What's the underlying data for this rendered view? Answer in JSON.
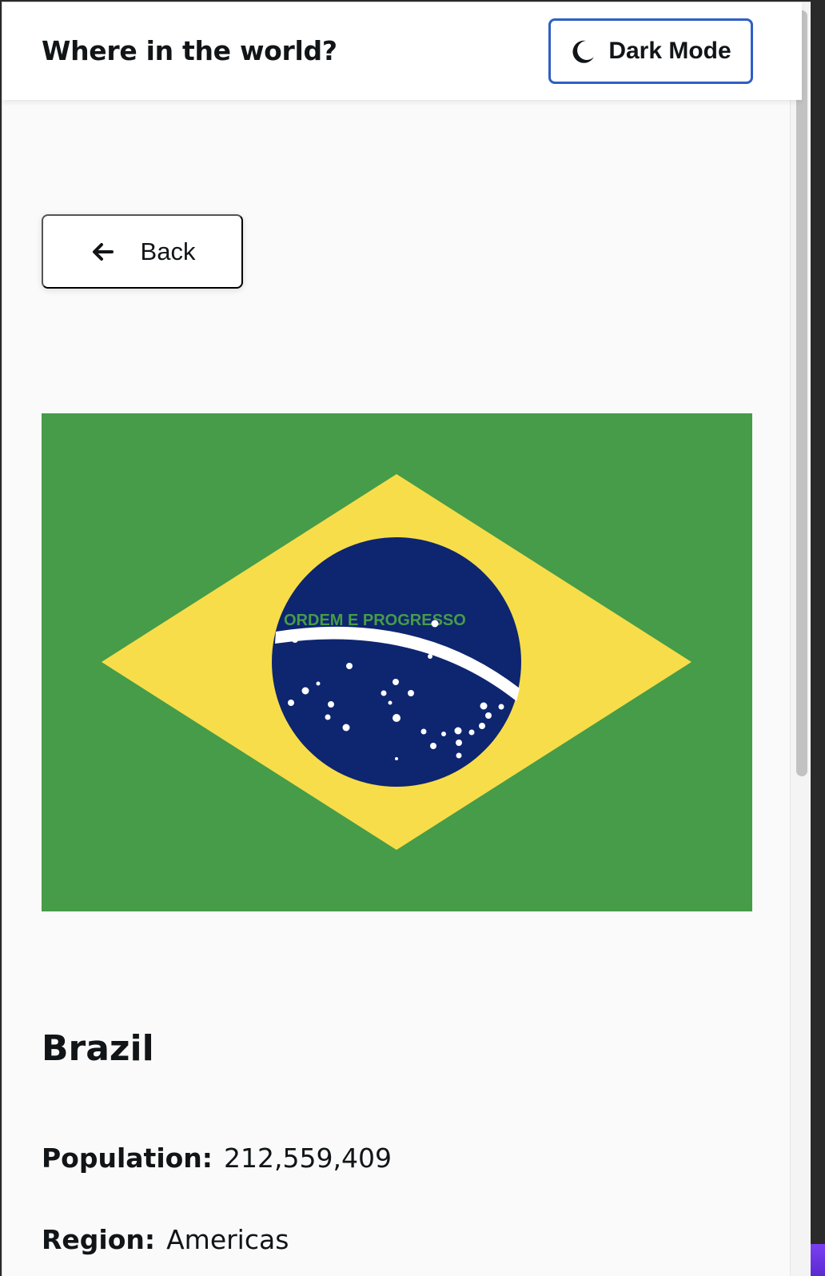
{
  "header": {
    "title": "Where in the world?",
    "mode_button": {
      "label": "Dark Mode",
      "icon": "moon-icon"
    }
  },
  "nav": {
    "back_label": "Back",
    "back_icon": "arrow-left-icon"
  },
  "country": {
    "flag_name": "Brazil flag",
    "flag_motto": "ORDEM E PROGRESSO",
    "name": "Brazil",
    "details": [
      {
        "key": "Population:",
        "value": "212,559,409"
      },
      {
        "key": "Region:",
        "value": "Americas"
      }
    ]
  },
  "colors": {
    "accent_border": "#2f5fc4",
    "text": "#111517",
    "background": "#fafafa",
    "flag_green": "#469c48",
    "flag_yellow": "#f7dd4a",
    "flag_blue": "#0e2570"
  }
}
